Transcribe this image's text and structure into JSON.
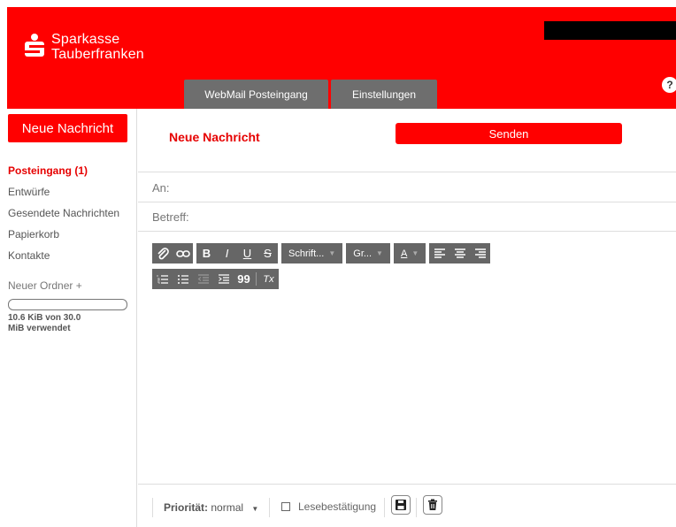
{
  "header": {
    "logo_line1": "Sparkasse",
    "logo_line2": "Tauberfranken",
    "tabs": [
      {
        "label": "WebMail Posteingang"
      },
      {
        "label": "Einstellungen"
      }
    ],
    "help_label": "?"
  },
  "sidebar": {
    "new_message_label": "Neue Nachricht",
    "folders": [
      {
        "label": "Posteingang (1)",
        "active": true
      },
      {
        "label": "Entwürfe"
      },
      {
        "label": "Gesendete Nachrichten"
      },
      {
        "label": "Papierkorb"
      },
      {
        "label": "Kontakte"
      }
    ],
    "new_folder_label": "Neuer Ordner +",
    "quota_text": "10.6 KiB von 30.0 MiB verwendet"
  },
  "compose": {
    "title": "Neue Nachricht",
    "send_label": "Senden",
    "to_label": "An:",
    "subject_label": "Betreff:",
    "toolbar": {
      "bold": "B",
      "italic": "I",
      "underline": "U",
      "strike": "S",
      "font_label": "Schrift...",
      "size_label": "Gr...",
      "color_label": "A",
      "quote_label": "99",
      "clear_format_label": "Tx"
    }
  },
  "bottom": {
    "priority_label": "Priorität:",
    "priority_value": "normal",
    "read_receipt_label": "Lesebestätigung"
  },
  "colors": {
    "brand_red": "#ff0000",
    "tab_gray": "#6e6e6e",
    "toolbar_gray": "#666666"
  }
}
